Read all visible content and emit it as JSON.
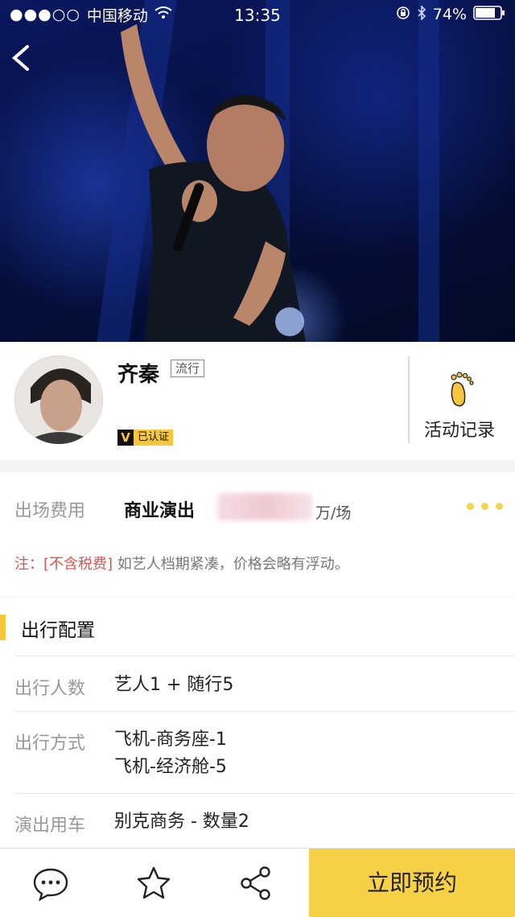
{
  "status_bar": {
    "carrier": "中国移动",
    "time": "13:35",
    "battery": "74%"
  },
  "profile": {
    "name": "齐秦",
    "genre": "流行",
    "verified_label": "已认证",
    "verified_badge": "V",
    "activity_label": "活动记录"
  },
  "price": {
    "label": "出场费用",
    "type": "商业演出",
    "unit": "万/场",
    "note_prefix": "注：",
    "note_tag": "[不含税费]",
    "note_text": " 如艺人档期紧凑，价格会略有浮动。"
  },
  "travel": {
    "section_title": "出行配置",
    "rows": [
      {
        "label": "出行人数",
        "value": "艺人1 + 随行5"
      },
      {
        "label": "出行方式",
        "value": "飞机-商务座-1",
        "value2": "飞机-经济舱-5"
      },
      {
        "label": "演出用车",
        "value": "别克商务 - 数量2"
      }
    ]
  },
  "bottom_bar": {
    "book_label": "立即预约",
    "icons": [
      "chat-icon",
      "star-icon",
      "share-icon"
    ]
  },
  "colors": {
    "accent": "#f6d146",
    "note_red": "#d9534f"
  }
}
